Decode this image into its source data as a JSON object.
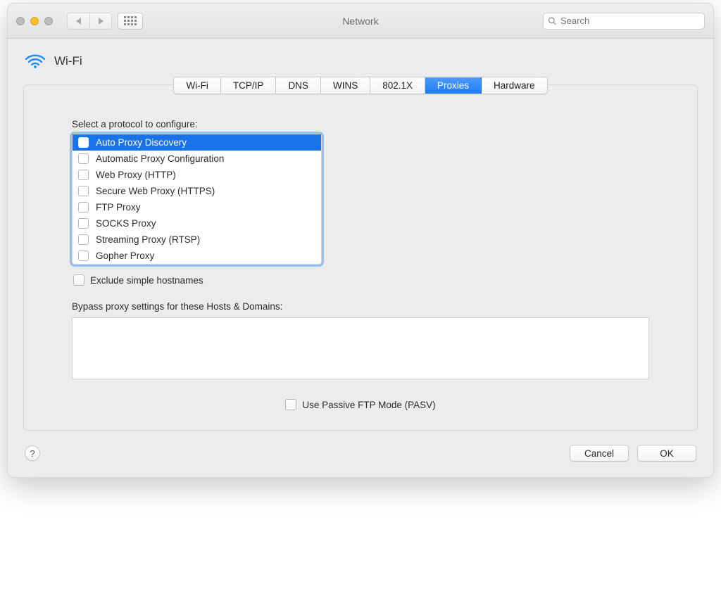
{
  "window": {
    "title": "Network",
    "search_placeholder": "Search"
  },
  "header": {
    "label": "Wi-Fi"
  },
  "tabs": {
    "items": [
      {
        "label": "Wi-Fi"
      },
      {
        "label": "TCP/IP"
      },
      {
        "label": "DNS"
      },
      {
        "label": "WINS"
      },
      {
        "label": "802.1X"
      },
      {
        "label": "Proxies"
      },
      {
        "label": "Hardware"
      }
    ],
    "selected_index": 5
  },
  "protocols": {
    "section_label": "Select a protocol to configure:",
    "items": [
      {
        "label": "Auto Proxy Discovery",
        "checked": false,
        "selected": true
      },
      {
        "label": "Automatic Proxy Configuration",
        "checked": false,
        "selected": false
      },
      {
        "label": "Web Proxy (HTTP)",
        "checked": false,
        "selected": false
      },
      {
        "label": "Secure Web Proxy (HTTPS)",
        "checked": false,
        "selected": false
      },
      {
        "label": "FTP Proxy",
        "checked": false,
        "selected": false
      },
      {
        "label": "SOCKS Proxy",
        "checked": false,
        "selected": false
      },
      {
        "label": "Streaming Proxy (RTSP)",
        "checked": false,
        "selected": false
      },
      {
        "label": "Gopher Proxy",
        "checked": false,
        "selected": false
      }
    ]
  },
  "exclude_simple": {
    "label": "Exclude simple hostnames",
    "checked": false
  },
  "bypass": {
    "label": "Bypass proxy settings for these Hosts & Domains:",
    "value": ""
  },
  "pasv": {
    "label": "Use Passive FTP Mode (PASV)",
    "checked": false
  },
  "footer": {
    "cancel": "Cancel",
    "ok": "OK",
    "help_tooltip": "?"
  }
}
